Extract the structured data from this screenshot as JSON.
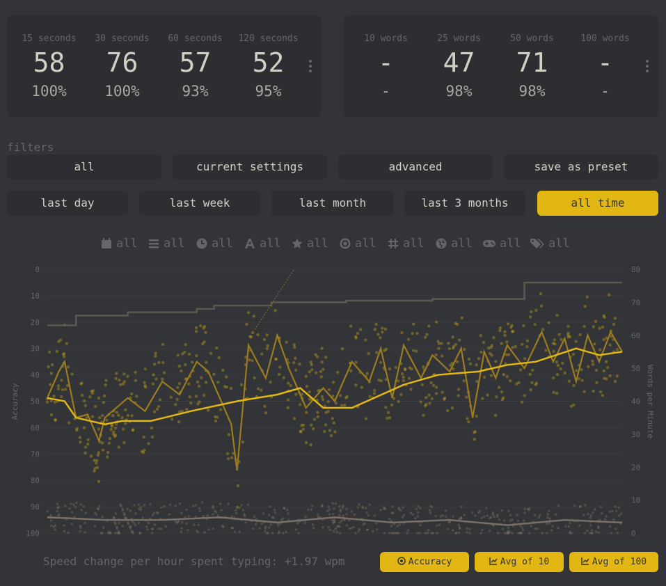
{
  "time_pbs": [
    {
      "label": "15 seconds",
      "wpm": "58",
      "acc": "100%"
    },
    {
      "label": "30 seconds",
      "wpm": "76",
      "acc": "100%"
    },
    {
      "label": "60 seconds",
      "wpm": "57",
      "acc": "93%"
    },
    {
      "label": "120 seconds",
      "wpm": "52",
      "acc": "95%"
    }
  ],
  "word_pbs": [
    {
      "label": "10 words",
      "wpm": "-",
      "acc": "-"
    },
    {
      "label": "25 words",
      "wpm": "47",
      "acc": "98%"
    },
    {
      "label": "50 words",
      "wpm": "71",
      "acc": "98%"
    },
    {
      "label": "100 words",
      "wpm": "-",
      "acc": "-"
    }
  ],
  "filters": {
    "label": "filters",
    "preset_buttons": [
      "all",
      "current settings",
      "advanced",
      "save as preset"
    ],
    "date_buttons": [
      "last day",
      "last week",
      "last month",
      "last 3 months",
      "all time"
    ],
    "active_date": "all time",
    "tags": [
      {
        "icon": "calendar-icon",
        "label": "all"
      },
      {
        "icon": "list-icon",
        "label": "all"
      },
      {
        "icon": "clock-icon",
        "label": "all"
      },
      {
        "icon": "font-icon",
        "label": "all"
      },
      {
        "icon": "star-icon",
        "label": "all"
      },
      {
        "icon": "at-icon",
        "label": "all"
      },
      {
        "icon": "hash-icon",
        "label": "all"
      },
      {
        "icon": "globe-icon",
        "label": "all"
      },
      {
        "icon": "gamepad-icon",
        "label": "all"
      },
      {
        "icon": "tags-icon",
        "label": "all"
      }
    ]
  },
  "colors": {
    "accent": "#e2b714",
    "bg": "#323437",
    "sub": "#646669",
    "text": "#d1d0c5",
    "panel": "#2c2e31"
  },
  "chart_data": {
    "type": "scatter",
    "ylabel_left": "Accuracy",
    "ylabel_right": "Words per Minute",
    "left_ticks": [
      "0",
      "10",
      "20",
      "30",
      "40",
      "50",
      "60",
      "70",
      "80",
      "90",
      "100"
    ],
    "right_ticks": [
      "80",
      "70",
      "60",
      "50",
      "40",
      "30",
      "20",
      "10",
      "0"
    ],
    "ylim_left": [
      100,
      0
    ],
    "ylim_right": [
      0,
      80
    ],
    "series": [
      {
        "name": "Avg of 10"
      },
      {
        "name": "Avg of 100"
      },
      {
        "name": "Accuracy"
      }
    ],
    "pb_steps": [
      [
        0,
        63
      ],
      [
        0.05,
        66
      ],
      [
        0.14,
        67
      ],
      [
        0.26,
        68
      ],
      [
        0.29,
        69
      ],
      [
        0.39,
        70
      ],
      [
        0.52,
        70.5
      ],
      [
        0.67,
        71
      ],
      [
        0.83,
        76
      ],
      [
        1,
        76
      ]
    ],
    "avg100": [
      [
        0,
        41
      ],
      [
        0.03,
        40
      ],
      [
        0.05,
        35
      ],
      [
        0.1,
        33
      ],
      [
        0.13,
        34
      ],
      [
        0.18,
        34
      ],
      [
        0.25,
        37
      ],
      [
        0.33,
        40
      ],
      [
        0.4,
        42
      ],
      [
        0.44,
        44
      ],
      [
        0.48,
        38
      ],
      [
        0.53,
        38
      ],
      [
        0.62,
        45
      ],
      [
        0.68,
        48
      ],
      [
        0.75,
        49
      ],
      [
        0.8,
        51
      ],
      [
        0.85,
        52
      ],
      [
        0.92,
        56
      ],
      [
        0.96,
        54
      ],
      [
        1,
        55
      ]
    ],
    "avg10": [
      [
        0,
        41
      ],
      [
        0.02,
        49
      ],
      [
        0.03,
        52
      ],
      [
        0.05,
        35
      ],
      [
        0.07,
        36
      ],
      [
        0.09,
        28
      ],
      [
        0.1,
        35
      ],
      [
        0.14,
        41
      ],
      [
        0.17,
        37
      ],
      [
        0.2,
        46
      ],
      [
        0.23,
        42
      ],
      [
        0.26,
        52
      ],
      [
        0.28,
        49
      ],
      [
        0.32,
        33
      ],
      [
        0.33,
        19
      ],
      [
        0.35,
        57
      ],
      [
        0.38,
        47
      ],
      [
        0.4,
        60
      ],
      [
        0.42,
        50
      ],
      [
        0.45,
        38
      ],
      [
        0.48,
        44
      ],
      [
        0.5,
        40
      ],
      [
        0.53,
        52
      ],
      [
        0.56,
        46
      ],
      [
        0.58,
        56
      ],
      [
        0.6,
        41
      ],
      [
        0.62,
        57
      ],
      [
        0.65,
        47
      ],
      [
        0.67,
        54
      ],
      [
        0.7,
        49
      ],
      [
        0.72,
        56
      ],
      [
        0.74,
        35
      ],
      [
        0.76,
        55
      ],
      [
        0.78,
        47
      ],
      [
        0.8,
        57
      ],
      [
        0.83,
        50
      ],
      [
        0.86,
        61
      ],
      [
        0.88,
        52
      ],
      [
        0.9,
        59
      ],
      [
        0.92,
        46
      ],
      [
        0.94,
        60
      ],
      [
        0.96,
        52
      ],
      [
        0.98,
        61
      ],
      [
        1,
        55
      ]
    ],
    "accuracy_avg": [
      [
        0,
        94
      ],
      [
        0.1,
        95
      ],
      [
        0.2,
        95
      ],
      [
        0.3,
        94
      ],
      [
        0.4,
        96
      ],
      [
        0.5,
        94
      ],
      [
        0.6,
        96
      ],
      [
        0.7,
        95
      ],
      [
        0.8,
        97
      ],
      [
        0.9,
        95
      ],
      [
        1,
        96
      ]
    ]
  },
  "bottom": {
    "speed_text": "Speed change per hour spent typing: +1.97 wpm",
    "toggles": [
      "Accuracy",
      "Avg of 10",
      "Avg of 100"
    ]
  }
}
